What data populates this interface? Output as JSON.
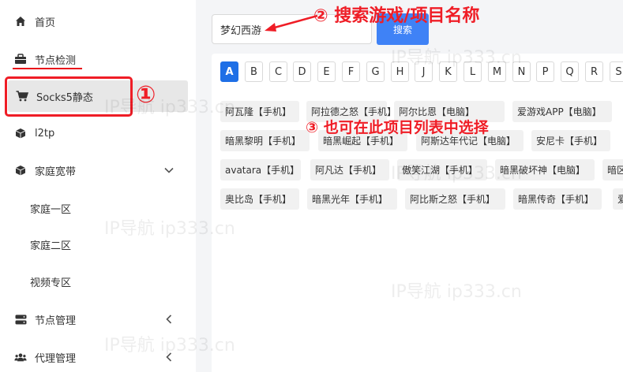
{
  "sidebar": {
    "items": [
      {
        "label": "首页",
        "icon": "home-icon"
      },
      {
        "label": "节点检测",
        "icon": "briefcase-icon"
      },
      {
        "label": "Socks5静态",
        "icon": "cart-icon"
      },
      {
        "label": "l2tp",
        "icon": "cube-icon"
      },
      {
        "label": "家庭宽带",
        "icon": "cube-icon"
      },
      {
        "label": "家庭一区"
      },
      {
        "label": "家庭二区"
      },
      {
        "label": "视频专区"
      },
      {
        "label": "节点管理",
        "icon": "server-icon"
      },
      {
        "label": "代理管理",
        "icon": "users-icon"
      }
    ]
  },
  "search": {
    "value": "梦幻西游",
    "button_label": "搜索"
  },
  "letters": [
    "A",
    "B",
    "C",
    "D",
    "E",
    "F",
    "G",
    "H",
    "J",
    "K",
    "L",
    "M",
    "N",
    "P",
    "Q",
    "R",
    "S"
  ],
  "active_letter": "A",
  "projects": [
    [
      "阿瓦隆【手机】",
      "阿拉德之怒【手机】",
      "阿尔比恩【电脑】",
      "爱游戏APP【电脑】"
    ],
    [
      "暗黑黎明【手机】",
      "暗黑崛起【手机】",
      "阿斯达年代记【电脑】",
      "安尼卡【手机】"
    ],
    [
      "avatara【手机】",
      "阿凡达【手机】",
      "傲笑江湖【手机】",
      "暗黑破坏神【电脑】",
      "暗区"
    ],
    [
      "奥比岛【手机】",
      "暗黑光年【手机】",
      "阿比斯之怒【手机】",
      "暗黑传奇【手机】",
      "爱"
    ]
  ],
  "annotations": {
    "step1": "①",
    "step2": "② 搜索游戏/项目名称",
    "step3": "③ 也可在此项目列表中选择"
  },
  "watermark": "IP导航 ip333.cn",
  "colors": {
    "accent": "#3f82f6",
    "active_letter": "#1e6fe6",
    "annotation": "#ef1d26"
  }
}
